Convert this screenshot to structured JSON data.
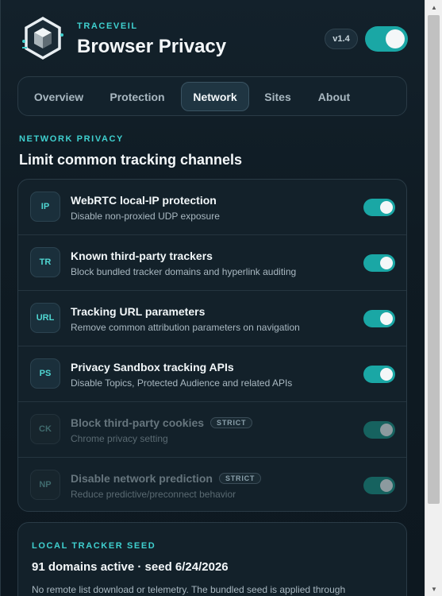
{
  "header": {
    "brand": "TRACEVEIL",
    "title": "Browser Privacy",
    "version": "v1.4",
    "master_enabled": true
  },
  "tabs": [
    {
      "label": "Overview",
      "active": false
    },
    {
      "label": "Protection",
      "active": false
    },
    {
      "label": "Network",
      "active": true
    },
    {
      "label": "Sites",
      "active": false
    },
    {
      "label": "About",
      "active": false
    }
  ],
  "section": {
    "kicker": "NETWORK PRIVACY",
    "title": "Limit common tracking channels"
  },
  "settings": [
    {
      "badge": "IP",
      "title": "WebRTC local-IP protection",
      "desc": "Disable non-proxied UDP exposure",
      "enabled": true,
      "disabled": false,
      "tag": ""
    },
    {
      "badge": "TR",
      "title": "Known third-party trackers",
      "desc": "Block bundled tracker domains and hyperlink auditing",
      "enabled": true,
      "disabled": false,
      "tag": ""
    },
    {
      "badge": "URL",
      "title": "Tracking URL parameters",
      "desc": "Remove common attribution parameters on navigation",
      "enabled": true,
      "disabled": false,
      "tag": ""
    },
    {
      "badge": "PS",
      "title": "Privacy Sandbox tracking APIs",
      "desc": "Disable Topics, Protected Audience and related APIs",
      "enabled": true,
      "disabled": false,
      "tag": ""
    },
    {
      "badge": "CK",
      "title": "Block third-party cookies",
      "desc": "Chrome privacy setting",
      "enabled": true,
      "disabled": true,
      "tag": "STRICT"
    },
    {
      "badge": "NP",
      "title": "Disable network prediction",
      "desc": "Reduce predictive/preconnect behavior",
      "enabled": true,
      "disabled": true,
      "tag": "STRICT"
    }
  ],
  "seed": {
    "kicker": "LOCAL TRACKER SEED",
    "title": "91 domains active · seed 6/24/2026",
    "desc": "No remote list download or telemetry. The bundled seed is applied through"
  },
  "colors": {
    "accent": "#3fd0cf",
    "toggle_on": "#1aa7a5",
    "background": "#0f1b23"
  }
}
